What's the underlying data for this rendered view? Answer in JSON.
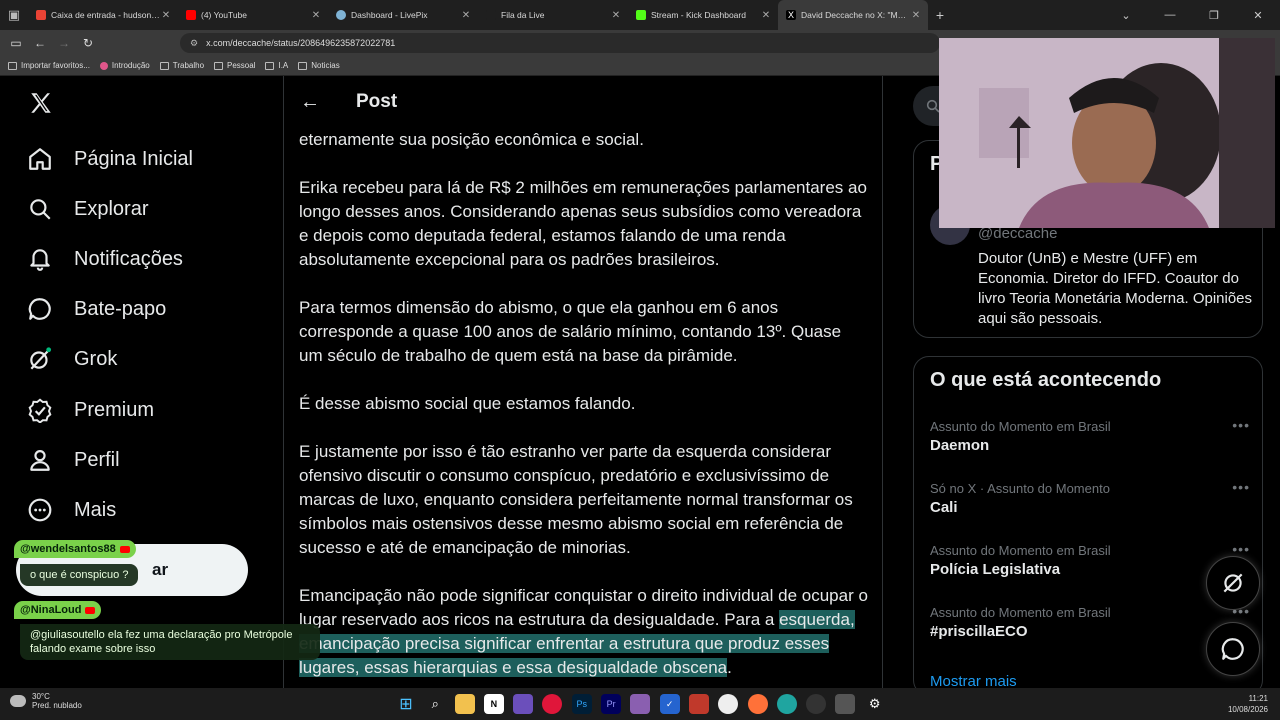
{
  "browser": {
    "tabs": [
      {
        "title": "Caixa de entrada - hudsonfabio",
        "favicon_color": "#ea4335",
        "active": false
      },
      {
        "title": "(4) YouTube",
        "favicon_color": "#ff0000",
        "active": false
      },
      {
        "title": "Dashboard - LivePix",
        "favicon_color": "#7fb3d5",
        "active": false
      },
      {
        "title": "Fila da Live",
        "favicon_color": "#1f1f1f",
        "active": false
      },
      {
        "title": "Stream - Kick Dashboard",
        "favicon_color": "#53fc18",
        "active": false
      },
      {
        "title": "David Deccache no X: \"Meu po",
        "favicon_color": "#000000",
        "active": true
      }
    ],
    "url": "x.com/deccache/status/2086496235872022781",
    "bookmarks": [
      "Importar favoritos...",
      "Introdução",
      "Trabalho",
      "Pessoal",
      "I.A",
      "Noticias"
    ]
  },
  "nav": {
    "items": [
      {
        "label": "Página Inicial",
        "icon": "home-icon"
      },
      {
        "label": "Explorar",
        "icon": "search-icon"
      },
      {
        "label": "Notificações",
        "icon": "bell-icon"
      },
      {
        "label": "Bate-papo",
        "icon": "chat-icon"
      },
      {
        "label": "Grok",
        "icon": "grok-icon"
      },
      {
        "label": "Premium",
        "icon": "premium-icon"
      },
      {
        "label": "Perfil",
        "icon": "profile-icon"
      },
      {
        "label": "Mais",
        "icon": "more-icon"
      }
    ],
    "post_button_partial": "ar"
  },
  "post": {
    "header_title": "Post",
    "paragraphs": [
      "eternamente sua posição econômica e social.",
      "Erika recebeu para lá de R$ 2 milhões em remunerações parlamentares ao longo desses anos. Considerando apenas seus subsídios como vereadora e depois como deputada federal, estamos falando de uma renda absolutamente excepcional para os padrões brasileiros.",
      "Para termos dimensão do abismo, o que ela ganhou em 6 anos corresponde a quase 100 anos de salário mínimo, contando 13º. Quase um século de trabalho de quem está na base da pirâmide.",
      "É desse abismo social que estamos falando.",
      "E justamente por isso é tão estranho ver parte da esquerda considerar ofensivo discutir o consumo conspícuo, predatório e exclusivíssimo de marcas de luxo, enquanto considera perfeitamente normal transformar os símbolos mais ostensivos desse mesmo abismo social em referência de sucesso e até de emancipação de minorias."
    ],
    "last_paragraph_plain": "Emancipação não pode significar conquistar o direito individual de ocupar o lugar reservado aos ricos na estrutura da desigualdade. Para a ",
    "last_paragraph_highlight": "esquerda, emancipação precisa significar enfrentar a estrutura que produz esses lugares, essas hierarquias e essa desigualdade obscena",
    "last_paragraph_end": "."
  },
  "sidebar": {
    "profile_head": "P",
    "handle": "@deccache",
    "bio": "Doutor (UnB) e Mestre (UFF) em Economia. Diretor do IFFD. Coautor do livro Teoria Monetária Moderna. Opiniões aqui são pessoais.",
    "trends_title": "O que está acontecendo",
    "trends": [
      {
        "context": "Assunto do Momento em Brasil",
        "name": "Daemon"
      },
      {
        "context": "Só no X · Assunto do Momento",
        "name": "Cali"
      },
      {
        "context": "Assunto do Momento em Brasil",
        "name": "Polícia Legislativa"
      },
      {
        "context": "Assunto do Momento em Brasil",
        "name": "#priscillaECO"
      }
    ],
    "show_more": "Mostrar mais"
  },
  "chat": [
    {
      "user": "@wendelsantos88",
      "message": "o que é conspicuo ?"
    },
    {
      "user": "@NinaLoud",
      "message": "@giuliasoutello ela fez uma declaração pro Metrópole falando exame sobre isso"
    }
  ],
  "taskbar": {
    "temperature": "30°C",
    "weather": "Pred. nublado",
    "time": "11:21",
    "date": "10/08/2026"
  },
  "colors": {
    "highlight": "#1d5f5c",
    "link": "#1d9bf0",
    "chat_user_bg": "#7ad14a"
  }
}
